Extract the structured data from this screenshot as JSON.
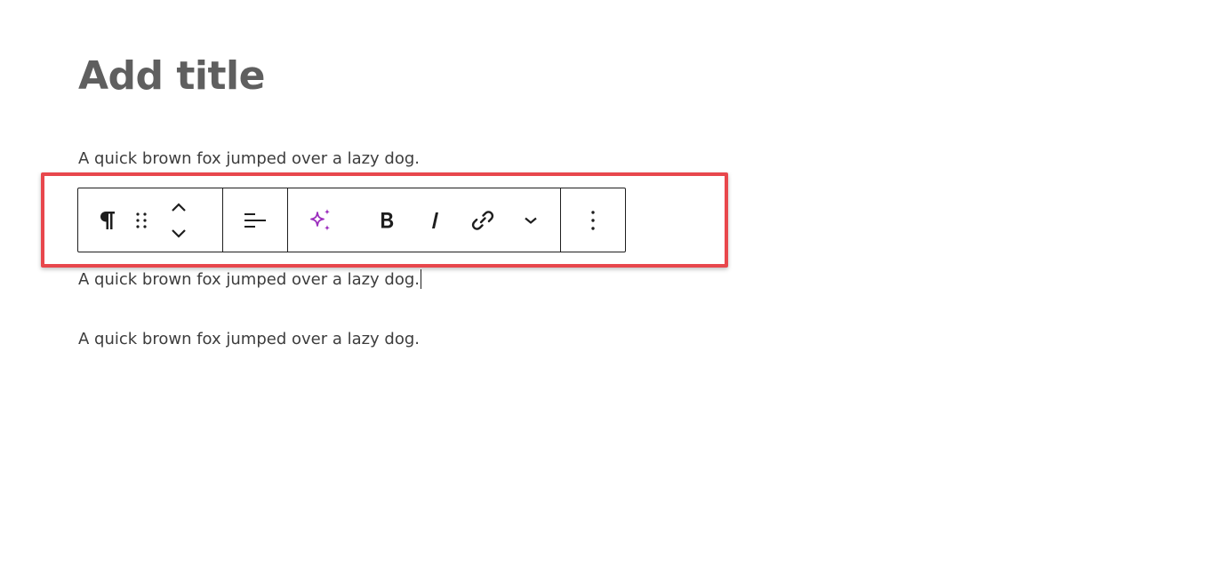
{
  "editor": {
    "title_placeholder": "Add title",
    "paragraphs": [
      "A quick brown fox jumped over a lazy dog.",
      "A quick brown fox jumped over a lazy dog.",
      "A quick brown fox jumped over a lazy dog."
    ]
  },
  "toolbar": {
    "buttons": [
      {
        "name": "paragraph-block-type",
        "icon": "pilcrow-icon"
      },
      {
        "name": "drag-handle",
        "icon": "drag-dots-icon"
      },
      {
        "name": "move-up-down",
        "icon": "chevron-up-down-icon"
      },
      {
        "name": "align-text",
        "icon": "align-left-icon"
      },
      {
        "name": "ai-assistant",
        "icon": "sparkle-icon"
      },
      {
        "name": "bold",
        "icon": "bold-icon"
      },
      {
        "name": "italic",
        "icon": "italic-icon"
      },
      {
        "name": "link",
        "icon": "link-icon"
      },
      {
        "name": "more-rich-text",
        "icon": "chevron-down-icon"
      },
      {
        "name": "options",
        "icon": "more-vertical-icon"
      }
    ]
  },
  "colors": {
    "highlight": "#e8474c",
    "ai_accent": "#9b2dbd",
    "toolbar_border": "#1e1e1e",
    "title": "#5f5f5f"
  }
}
